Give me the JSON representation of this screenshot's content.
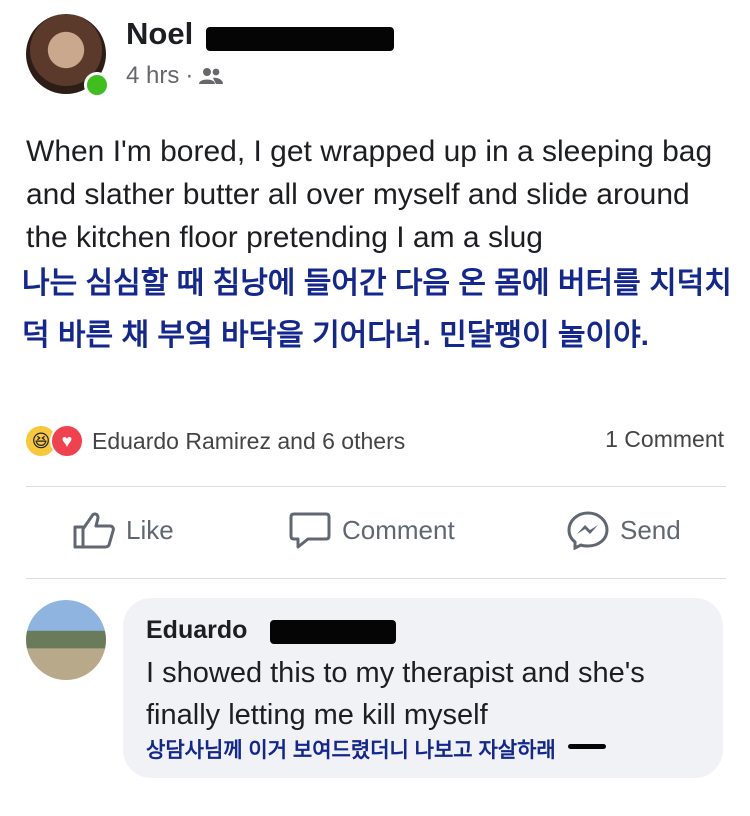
{
  "post": {
    "author_name": "Noel",
    "time": "4 hrs",
    "separator": "·",
    "audience_icon": "friends-icon",
    "text": "When I'm bored, I get wrapped up in a sleeping bag and slather butter all over myself and slide around the kitchen floor pretending I am a slug",
    "translation": "나는 심심할 때 침낭에 들어간 다음 온 몸에 버터를 치덕치덕 바른 채 부엌 바닥을 기어다녀. 민달팽이 놀이야."
  },
  "reactions": {
    "summary": "Eduardo Ramirez and 6 others",
    "comments": "1 Comment",
    "icons": [
      "haha-reaction-icon",
      "love-reaction-icon"
    ]
  },
  "actions": {
    "like_label": "Like",
    "comment_label": "Comment",
    "send_label": "Send"
  },
  "comment": {
    "author_name": "Eduardo",
    "text": "I showed this to my therapist and she's finally letting me kill myself",
    "translation": "상담사님께 이거 보여드렸더니 나보고 자살하래"
  },
  "colors": {
    "translation": "#13278f",
    "online": "#3fbf1f",
    "bubble": "#f0f2f5"
  }
}
